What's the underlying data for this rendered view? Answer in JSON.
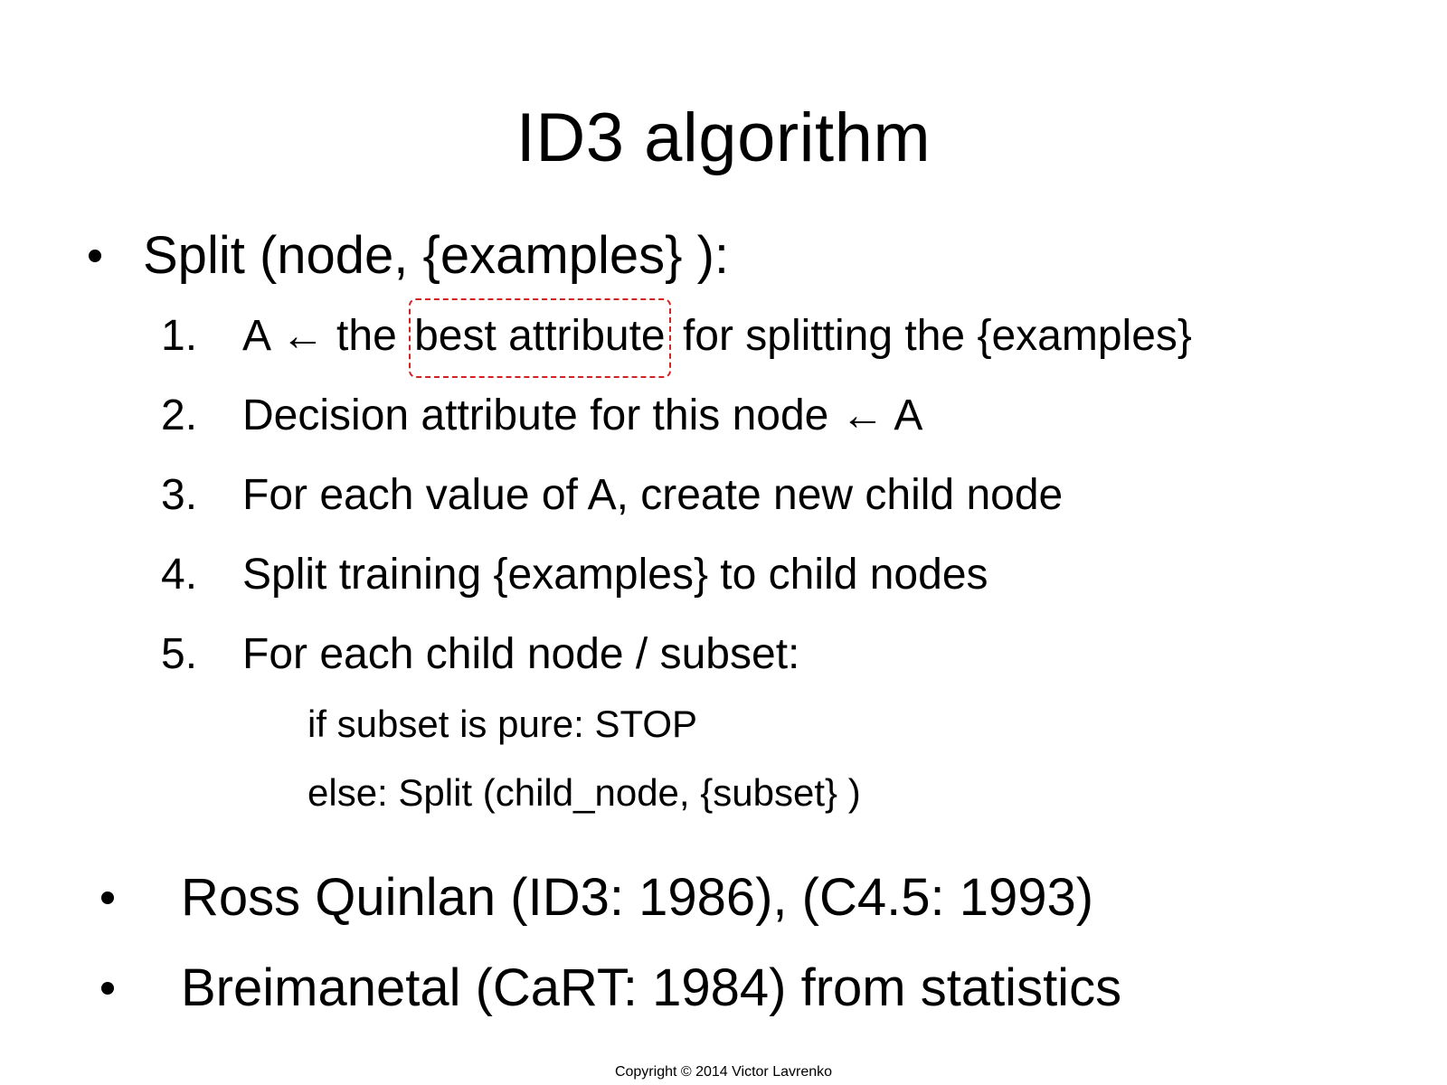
{
  "slide": {
    "title": "ID3 algorithm",
    "main_bullet": "Split (node, {examples} ):",
    "steps": [
      {
        "number": "1.",
        "before": "A ← the",
        "highlight": "best attribute",
        "after": "for splitting the {examples}"
      },
      {
        "number": "2.",
        "text": "Decision attribute for this node ← A"
      },
      {
        "number": "3.",
        "text": "For each value of A, create new child node"
      },
      {
        "number": "4.",
        "text": "Split training {examples} to child nodes"
      },
      {
        "number": "5.",
        "text": "For each child node / subset:"
      }
    ],
    "substeps": [
      "if subset is pure: STOP",
      "else: Split (child_node, {subset} )"
    ],
    "bullets": [
      "Ross Quinlan (ID3: 1986), (C4.5: 1993)",
      "Breimanetal (CaRT: 1984) from statistics"
    ],
    "copyright": "Copyright © 2014 Victor Lavrenko"
  },
  "colors": {
    "text": "#000000",
    "highlight_border": "#d22222",
    "background": "#ffffff"
  }
}
